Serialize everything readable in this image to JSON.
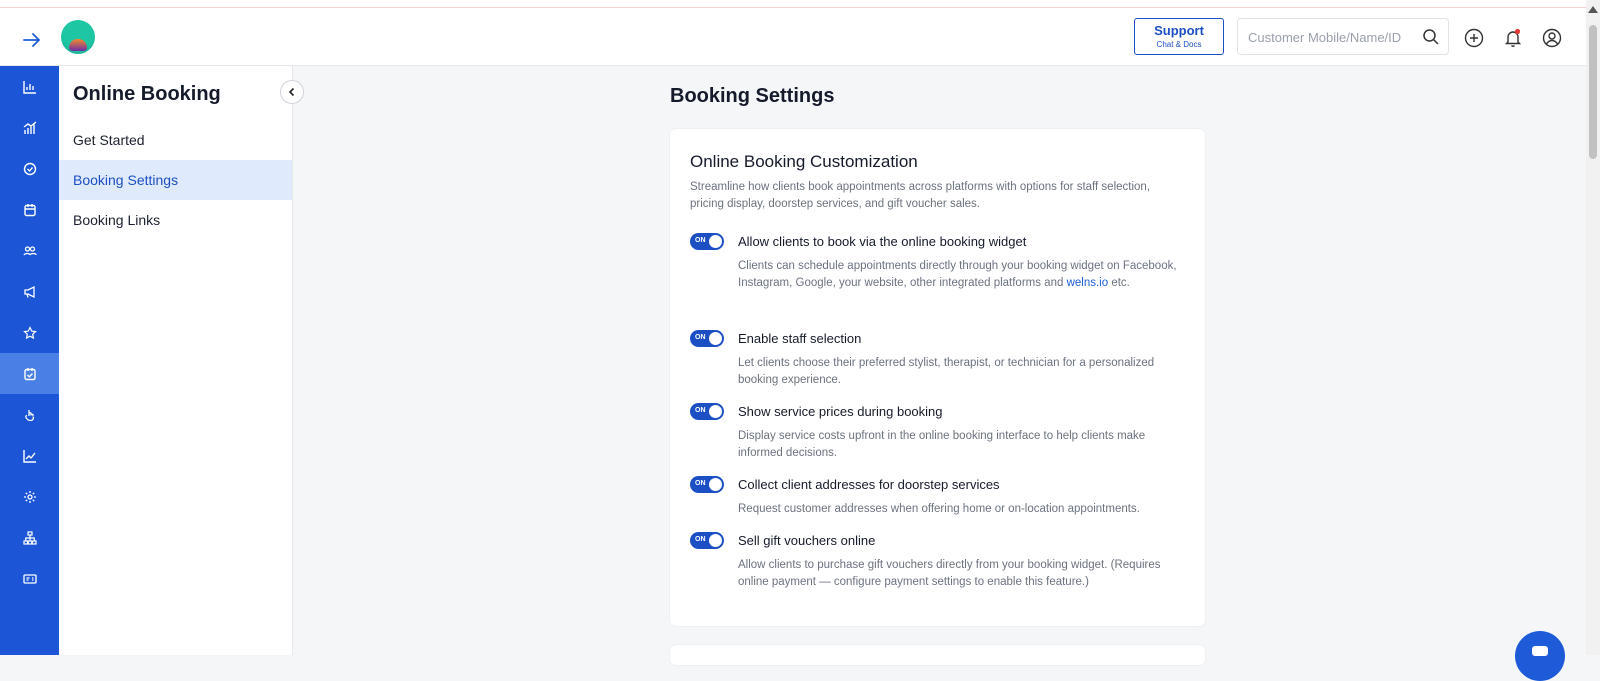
{
  "header": {
    "support": {
      "label": "Support",
      "sublabel": "Chat & Docs"
    },
    "search": {
      "placeholder": "Customer Mobile/Name/ID",
      "value": ""
    }
  },
  "rail": {
    "icons": [
      "dashboard-icon",
      "analytics-icon",
      "check-circle-icon",
      "calendar-icon",
      "customers-icon",
      "megaphone-icon",
      "star-icon",
      "booking-icon",
      "hand-icon",
      "trend-icon",
      "settings-icon",
      "hierarchy-icon",
      "id-card-icon"
    ],
    "active_index": 7
  },
  "subnav": {
    "title": "Online Booking",
    "items": [
      {
        "label": "Get Started"
      },
      {
        "label": "Booking Settings"
      },
      {
        "label": "Booking Links"
      }
    ],
    "active_index": 1
  },
  "main": {
    "page_title": "Booking Settings",
    "card": {
      "title": "Online Booking Customization",
      "description": "Streamline how clients book appointments across platforms with options for staff selection, pricing display, doorstep services, and gift voucher sales.",
      "options": [
        {
          "toggle": "ON",
          "title": "Allow clients to book via the online booking widget",
          "desc": "Clients can schedule appointments directly through your booking widget on Facebook, Instagram, Google, your website, other integrated platforms and",
          "link": "welns.io",
          "desc_after": "etc."
        },
        {
          "toggle": "ON",
          "title": "Enable staff selection",
          "desc": "Let clients choose their preferred stylist, therapist, or technician for a personalized booking experience."
        },
        {
          "toggle": "ON",
          "title": "Show service prices during booking",
          "desc": "Display service costs upfront in the online booking interface to help clients make informed decisions."
        },
        {
          "toggle": "ON",
          "title": "Collect client addresses for doorstep services",
          "desc": "Request customer addresses when offering home or on-location appointments."
        },
        {
          "toggle": "ON",
          "title": "Sell gift vouchers online",
          "desc": "Allow clients to purchase gift vouchers directly from your booking widget. (Requires online payment — configure payment settings to enable this feature.)"
        }
      ]
    }
  },
  "colors": {
    "primary": "#1c56d6",
    "accent": "#1d4fc4",
    "active_bg": "#dfeafc"
  }
}
